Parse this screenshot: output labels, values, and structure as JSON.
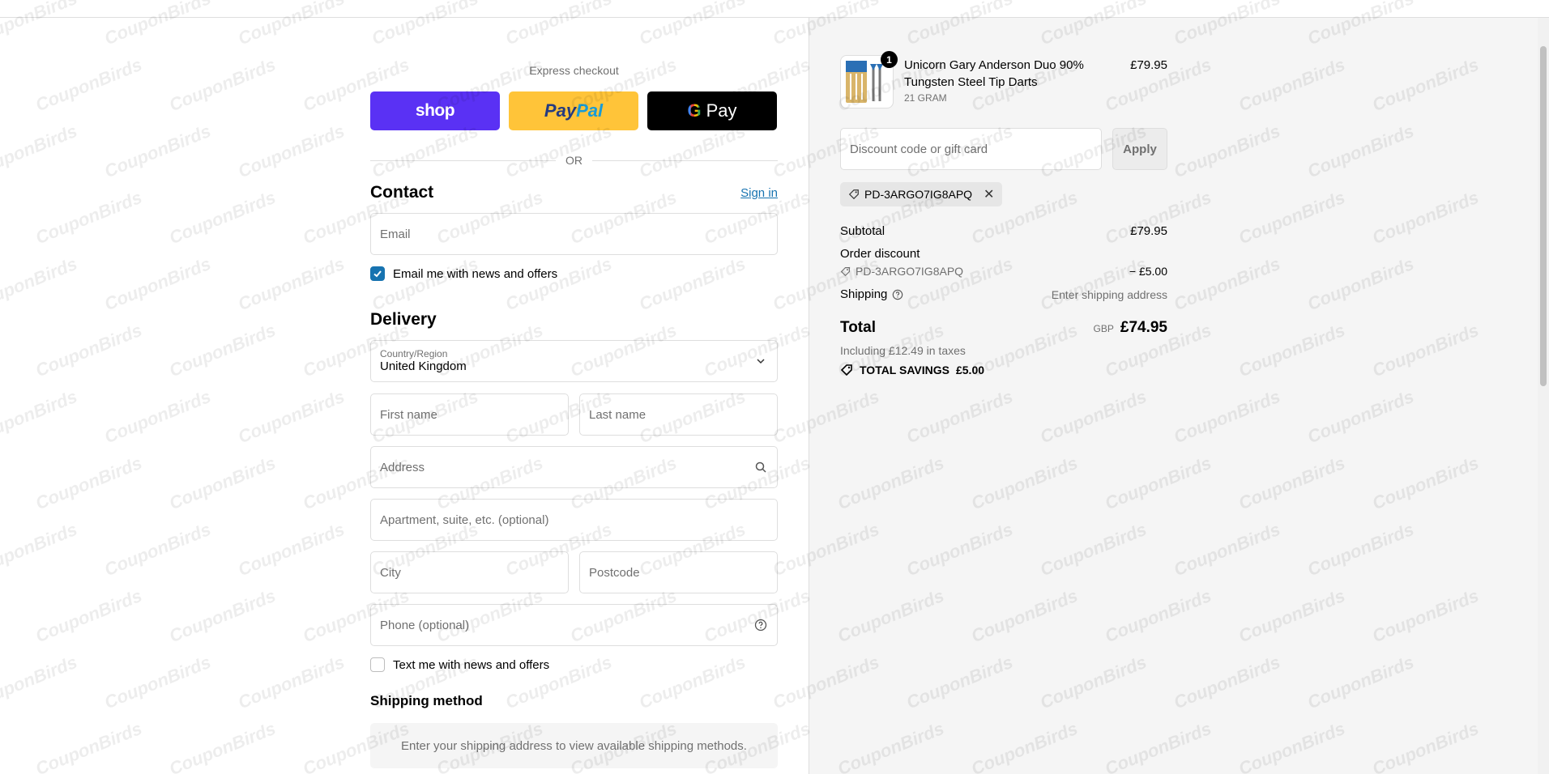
{
  "express": {
    "label": "Express checkout",
    "shop_label": "shop",
    "paypal_label_1": "Pay",
    "paypal_label_2": "Pal",
    "gpay_g": "G",
    "gpay_label": "Pay",
    "or_label": "OR"
  },
  "contact": {
    "heading": "Contact",
    "sign_in": "Sign in",
    "email_placeholder": "Email",
    "news_checkbox_label": "Email me with news and offers",
    "news_checked": true
  },
  "delivery": {
    "heading": "Delivery",
    "country_label": "Country/Region",
    "country_value": "United Kingdom",
    "first_name_placeholder": "First name",
    "last_name_placeholder": "Last name",
    "address_placeholder": "Address",
    "apartment_placeholder": "Apartment, suite, etc. (optional)",
    "city_placeholder": "City",
    "postcode_placeholder": "Postcode",
    "phone_placeholder": "Phone (optional)",
    "sms_checkbox_label": "Text me with news and offers",
    "sms_checked": false
  },
  "shipping_method": {
    "heading": "Shipping method",
    "message": "Enter your shipping address to view available shipping methods."
  },
  "summary": {
    "product": {
      "name": "Unicorn Gary Anderson Duo 90% Tungsten Steel Tip Darts",
      "variant": "21 GRAM",
      "price": "£79.95",
      "quantity": "1"
    },
    "discount_placeholder": "Discount code or gift card",
    "apply_label": "Apply",
    "applied_code": "PD-3ARGO7IG8APQ",
    "subtotal_label": "Subtotal",
    "subtotal_value": "£79.95",
    "order_discount_label": "Order discount",
    "order_discount_code": "PD-3ARGO7IG8APQ",
    "order_discount_value": "− £5.00",
    "shipping_label": "Shipping",
    "shipping_value": "Enter shipping address",
    "total_label": "Total",
    "total_currency": "GBP",
    "total_value": "£74.95",
    "taxes_note": "Including £12.49 in taxes",
    "savings_label": "TOTAL SAVINGS",
    "savings_value": "£5.00"
  },
  "watermark": "CouponBirds",
  "colors": {
    "shop": "#5a31f4",
    "paypal": "#ffc439",
    "gpay": "#000000",
    "link": "#1773b0",
    "summary_bg": "#f5f5f5"
  }
}
